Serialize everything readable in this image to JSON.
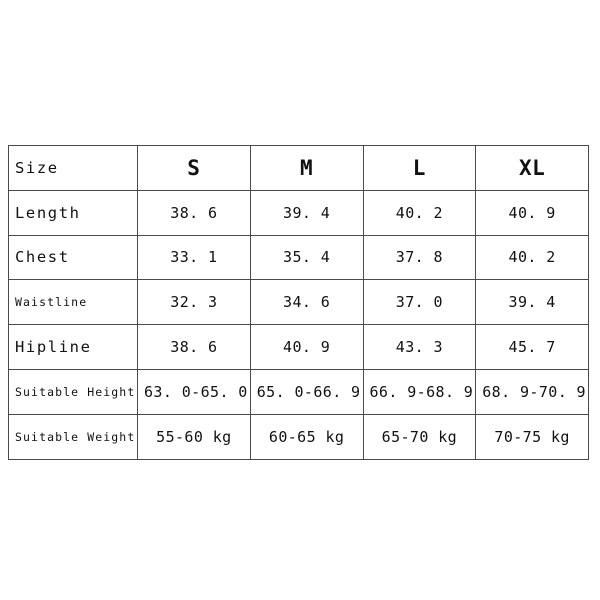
{
  "chart_data": {
    "type": "table",
    "title": "",
    "columns": [
      "Size",
      "S",
      "M",
      "L",
      "XL"
    ],
    "row_labels": [
      "Size",
      "Length",
      "Chest",
      "Waistline",
      "Hipline",
      "Suitable Height",
      "Suitable Weight"
    ],
    "rows": [
      {
        "label": "Size",
        "values": [
          "S",
          "M",
          "L",
          "XL"
        ]
      },
      {
        "label": "Length",
        "values": [
          "38. 6",
          "39. 4",
          "40. 2",
          "40. 9"
        ]
      },
      {
        "label": "Chest",
        "values": [
          "33. 1",
          "35. 4",
          "37. 8",
          "40. 2"
        ]
      },
      {
        "label": "Waistline",
        "values": [
          "32. 3",
          "34. 6",
          "37. 0",
          "39. 4"
        ]
      },
      {
        "label": "Hipline",
        "values": [
          "38. 6",
          "40. 9",
          "43. 3",
          "45. 7"
        ]
      },
      {
        "label": "Suitable Height",
        "values": [
          "63. 0-65. 0",
          "65. 0-66. 9",
          "66. 9-68. 9",
          "68. 9-70. 9"
        ]
      },
      {
        "label": "Suitable Weight",
        "values": [
          "55-60 kg",
          "60-65 kg",
          "65-70 kg",
          "70-75 kg"
        ]
      }
    ],
    "colors": {
      "background": "#ffffff",
      "border": "#4a4a4a",
      "text": "#121212"
    }
  },
  "table": {
    "header": {
      "label": "Size",
      "sizes": [
        "S",
        "M",
        "L",
        "XL"
      ]
    },
    "measurements": [
      {
        "label": "Length",
        "s": "38. 6",
        "m": "39. 4",
        "l": "40. 2",
        "xl": "40. 9"
      },
      {
        "label": "Chest",
        "s": "33. 1",
        "m": "35. 4",
        "l": "37. 8",
        "xl": "40. 2"
      },
      {
        "label": "Waistline",
        "s": "32. 3",
        "m": "34. 6",
        "l": "37. 0",
        "xl": "39. 4"
      },
      {
        "label": "Hipline",
        "s": "38. 6",
        "m": "40. 9",
        "l": "43. 3",
        "xl": "45. 7"
      },
      {
        "label": "Suitable Height",
        "s": "63. 0-65. 0",
        "m": "65. 0-66. 9",
        "l": "66. 9-68. 9",
        "xl": "68. 9-70. 9"
      },
      {
        "label": "Suitable Weight",
        "s": "55-60 kg",
        "m": "60-65 kg",
        "l": "65-70 kg",
        "xl": "70-75 kg"
      }
    ]
  }
}
